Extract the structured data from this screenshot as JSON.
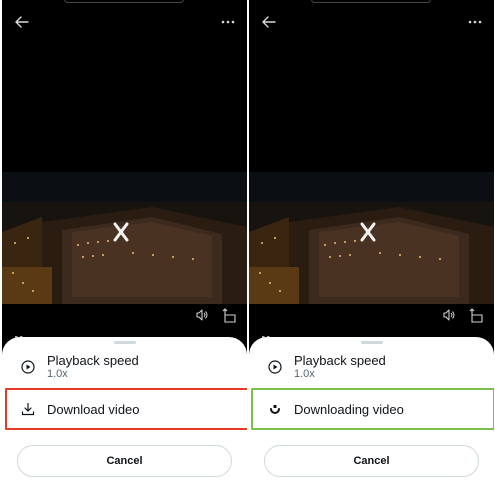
{
  "panels": [
    {
      "id": "before",
      "menu": {
        "speed_title": "Playback speed",
        "speed_value": "1.0x",
        "download_label": "Download video",
        "cancel_label": "Cancel"
      },
      "highlight_color": "#e63a25",
      "download_icon": "download-icon"
    },
    {
      "id": "after",
      "menu": {
        "speed_title": "Playback speed",
        "speed_value": "1.0x",
        "download_label": "Downloading video",
        "cancel_label": "Cancel"
      },
      "highlight_color": "#7cc04b",
      "download_icon": "spinner-icon"
    }
  ],
  "icons": {
    "top_left": "back-arrow-icon",
    "top_right": "more-options-icon",
    "video_controls": [
      "speaker-icon",
      "rotate-screen-icon"
    ],
    "speed_icon": "play-circle-icon"
  },
  "colors": {
    "sheet_background": "#ffffff",
    "primary_text": "#0f1419",
    "secondary_text": "#536471",
    "border": "#cfd9de"
  }
}
